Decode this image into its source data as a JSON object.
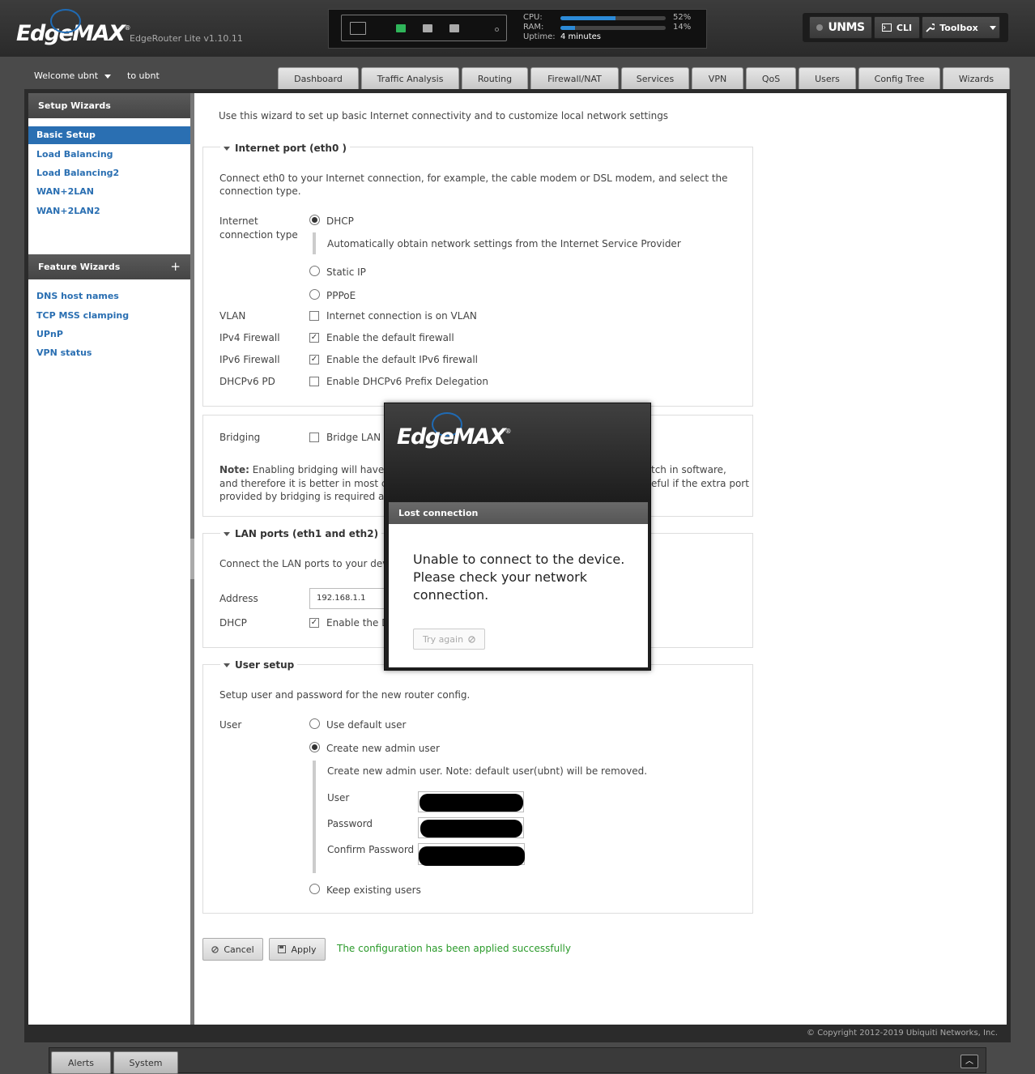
{
  "header": {
    "brand": "EdgeMAX",
    "brand_mark": "®",
    "model": "EdgeRouter Lite v1.10.11",
    "stats": {
      "cpu_label": "CPU:",
      "cpu_value": "52%",
      "cpu_fraction": 0.52,
      "ram_label": "RAM:",
      "ram_value": "14%",
      "ram_fraction": 0.14,
      "uptime_label": "Uptime:",
      "uptime_value": "4 minutes"
    },
    "buttons": {
      "unms": "UNMS",
      "cli": "CLI",
      "toolbox": "Toolbox"
    },
    "port_colors": {
      "active": "#2fb55a",
      "idle": "#aaaaaa"
    }
  },
  "welcome": {
    "label": "Welcome ubnt",
    "to_user": "to ubnt"
  },
  "tabs": [
    {
      "label": "Dashboard"
    },
    {
      "label": "Traffic Analysis"
    },
    {
      "label": "Routing"
    },
    {
      "label": "Firewall/NAT"
    },
    {
      "label": "Services"
    },
    {
      "label": "VPN"
    },
    {
      "label": "QoS"
    },
    {
      "label": "Users"
    },
    {
      "label": "Config Tree"
    },
    {
      "label": "Wizards"
    }
  ],
  "sidebar": {
    "setup_title": "Setup Wizards",
    "setup_items": [
      "Basic Setup",
      "Load Balancing",
      "Load Balancing2",
      "WAN+2LAN",
      "WAN+2LAN2"
    ],
    "feature_title": "Feature Wizards",
    "feature_add": "+",
    "feature_items": [
      "DNS host names",
      "TCP MSS clamping",
      "UPnP",
      "VPN status"
    ]
  },
  "content": {
    "intro": "Use this wizard to set up basic Internet connectivity and to customize local network settings",
    "internet": {
      "legend": "Internet port (eth0 )",
      "desc_line1": "Connect eth0 to your Internet connection, for example, the cable modem or DSL modem, and select the",
      "desc_line2": "connection type.",
      "conn_type_label1": "Internet",
      "conn_type_label2": "connection type",
      "dhcp": "DHCP",
      "dhcp_desc": "Automatically obtain network settings from the Internet Service Provider",
      "static": "Static IP",
      "pppoe": "PPPoE",
      "vlan_label": "VLAN",
      "vlan_text": "Internet connection is on VLAN",
      "ipv4_label": "IPv4 Firewall",
      "ipv4_text": "Enable the default firewall",
      "ipv6_label": "IPv6 Firewall",
      "ipv6_text": "Enable the default IPv6 firewall",
      "pd_label": "DHCPv6 PD",
      "pd_text": "Enable DHCPv6 Prefix Delegation"
    },
    "bridging": {
      "label": "Bridging",
      "text": "Bridge LAN in",
      "note_bold": "Note:",
      "note_l1a": "Enabling bridging will have pe",
      "note_l1b": "tch in software,",
      "note_l2a": "and therefore it is better in most cas",
      "note_l2b": "eful if the extra port",
      "note_l3a": "provided by bridging is required and"
    },
    "lan": {
      "legend": "LAN ports (eth1 and eth2)",
      "desc": "Connect the LAN ports to your devic",
      "address_label": "Address",
      "address_value": "192.168.1.1",
      "dhcp_label": "DHCP",
      "dhcp_text": "Enable the D"
    },
    "user": {
      "legend": "User setup",
      "desc": "Setup user and password for the new router config.",
      "label": "User",
      "default": "Use default user",
      "create": "Create new admin user",
      "create_note": "Create new admin user. Note: default user(ubnt) will be removed.",
      "user_label": "User",
      "password_label": "Password",
      "confirm_label": "Confirm Password",
      "keep": "Keep existing users"
    },
    "cancel": "Cancel",
    "apply": "Apply",
    "success": "The configuration has been applied successfully"
  },
  "modal": {
    "brand": "EdgeMAX",
    "title": "Lost connection",
    "message": "Unable to connect to the device. Please check your network connection.",
    "retry": "Try again"
  },
  "footer": {
    "copyright": "© Copyright 2012-2019 Ubiquiti Networks, Inc.",
    "alerts": "Alerts",
    "system": "System"
  }
}
